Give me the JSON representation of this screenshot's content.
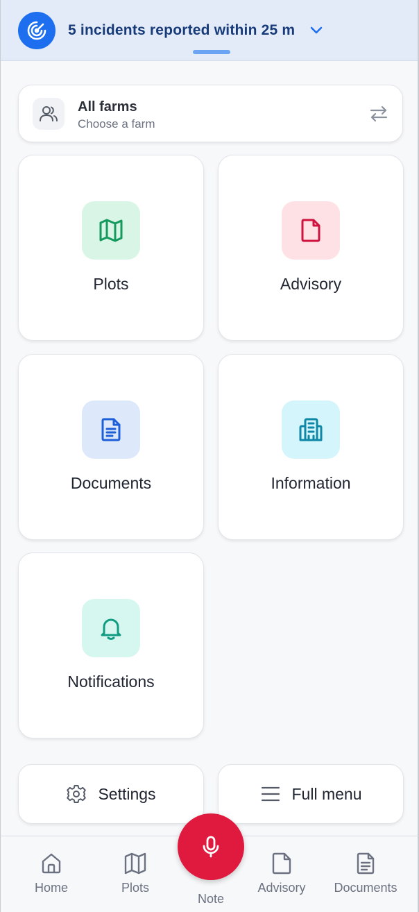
{
  "banner": {
    "text": "5 incidents reported within 25 m",
    "icon": "radar-icon",
    "accent": "#1d6ff0"
  },
  "farm_selector": {
    "title": "All farms",
    "subtitle": "Choose a farm",
    "icon": "users-icon",
    "action_icon": "swap-arrows-icon"
  },
  "tiles": [
    {
      "label": "Plots",
      "icon": "map-icon",
      "bg": "#d9f5e6",
      "color": "#139a5c"
    },
    {
      "label": "Advisory",
      "icon": "file-icon",
      "bg": "#fde1e5",
      "color": "#d0123e"
    },
    {
      "label": "Documents",
      "icon": "document-icon",
      "bg": "#dde9fb",
      "color": "#1d5fd6"
    },
    {
      "label": "Information",
      "icon": "building-icon",
      "bg": "#d3f5fb",
      "color": "#0f88a8"
    },
    {
      "label": "Notifications",
      "icon": "bell-icon",
      "bg": "#d5f7ef",
      "color": "#0f9c82"
    }
  ],
  "quick_actions": {
    "settings": "Settings",
    "full_menu": "Full menu"
  },
  "nav": {
    "home": "Home",
    "plots": "Plots",
    "note": "Note",
    "advisory": "Advisory",
    "documents": "Documents",
    "mic_color": "#e0193e"
  }
}
